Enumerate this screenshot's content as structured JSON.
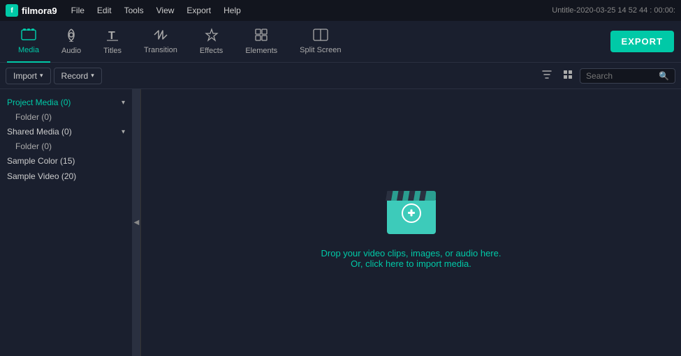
{
  "titleBar": {
    "appName": "filmora9",
    "menuItems": [
      "File",
      "Edit",
      "Tools",
      "View",
      "Export",
      "Help"
    ],
    "titleText": "Untitle-2020-03-25 14 52 44 : 00:00:"
  },
  "tabs": [
    {
      "id": "media",
      "label": "Media",
      "icon": "🎬",
      "active": true
    },
    {
      "id": "audio",
      "label": "Audio",
      "icon": "🎵",
      "active": false
    },
    {
      "id": "titles",
      "label": "Titles",
      "icon": "T",
      "active": false
    },
    {
      "id": "transition",
      "label": "Transition",
      "icon": "↔",
      "active": false
    },
    {
      "id": "effects",
      "label": "Effects",
      "icon": "✦",
      "active": false
    },
    {
      "id": "elements",
      "label": "Elements",
      "icon": "⊞",
      "active": false
    },
    {
      "id": "split-screen",
      "label": "Split Screen",
      "icon": "⊡",
      "active": false
    }
  ],
  "exportButton": "EXPORT",
  "sidebar": {
    "items": [
      {
        "id": "project-media",
        "label": "Project Media (0)",
        "active": true,
        "hasChevron": true,
        "expanded": true
      },
      {
        "id": "folder-0",
        "label": "Folder (0)",
        "isSub": true
      },
      {
        "id": "shared-media",
        "label": "Shared Media (0)",
        "active": false,
        "hasChevron": true,
        "expanded": true
      },
      {
        "id": "folder-0-2",
        "label": "Folder (0)",
        "isSub": true
      },
      {
        "id": "sample-color",
        "label": "Sample Color (15)",
        "active": false,
        "hasChevron": false
      },
      {
        "id": "sample-video",
        "label": "Sample Video (20)",
        "active": false,
        "hasChevron": false
      }
    ]
  },
  "toolbar": {
    "importLabel": "Import",
    "recordLabel": "Record",
    "searchPlaceholder": "Search"
  },
  "dropZone": {
    "mainText": "Drop your video clips, images, or audio here.",
    "subText": "Or, click here to import media."
  }
}
